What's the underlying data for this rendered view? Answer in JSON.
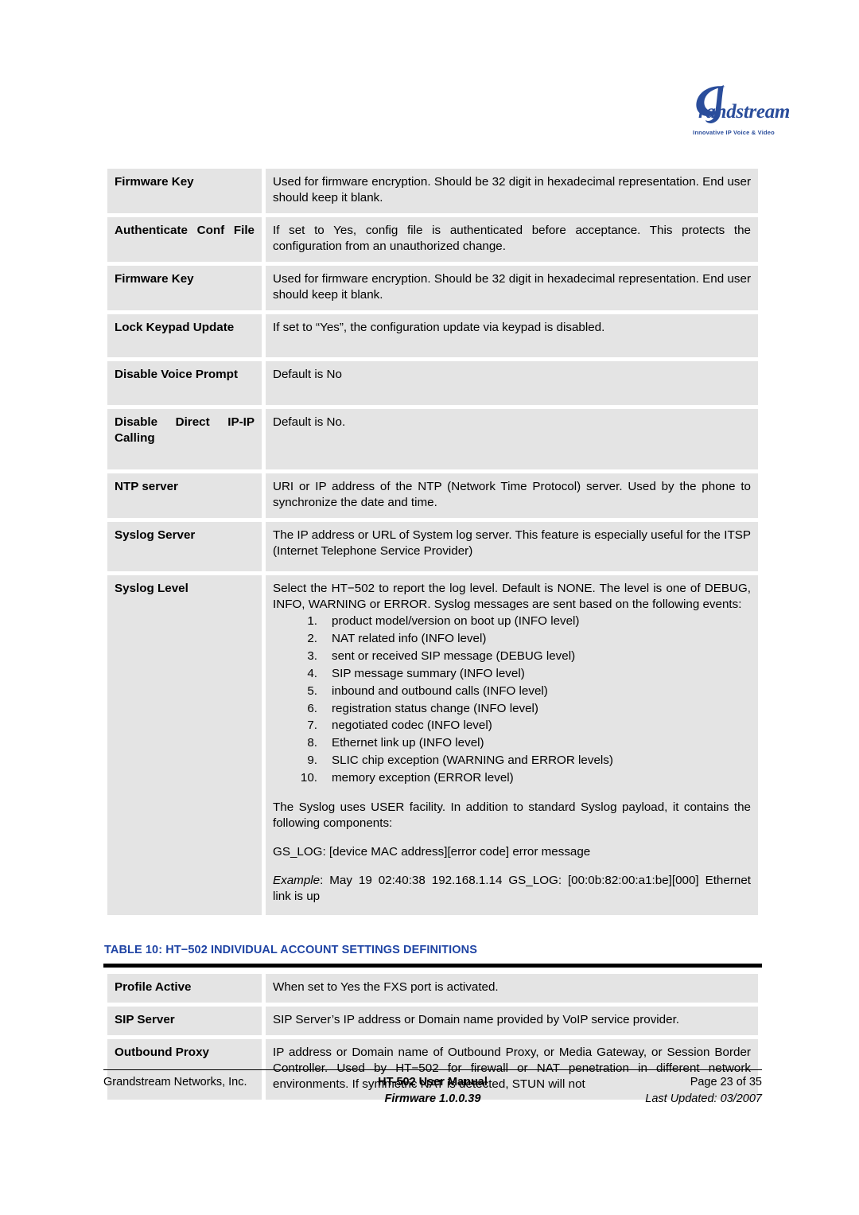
{
  "logo": {
    "wordmark": "randstream",
    "initial": "G",
    "tagline": "Innovative IP Voice & Video",
    "color": "#2a4d9b"
  },
  "advanced_table": {
    "rows": [
      {
        "key": "Firmware Key",
        "value": "Used for firmware encryption.  Should be 32 digit in hexadecimal representation. End user should keep it blank."
      },
      {
        "key": "Authenticate Conf File",
        "value": "If set to Yes, config file is authenticated before acceptance.  This protects the configuration from an unauthorized change."
      },
      {
        "key": "Firmware Key",
        "value": "Used for firmware encryption.  Should be 32 digit in hexadecimal representation. End user should keep it blank."
      },
      {
        "key": "Lock Keypad Update",
        "value": "If set to “Yes”, the configuration update via keypad is disabled."
      },
      {
        "key": "Disable Voice Prompt",
        "value": "Default is No"
      },
      {
        "key": "Disable Direct IP-IP Calling",
        "value": "Default is No."
      },
      {
        "key": "NTP server",
        "value": "URI or IP address of the NTP (Network Time Protocol) server.  Used by the phone to synchronize the date and time."
      },
      {
        "key": "Syslog Server",
        "value": "The IP address or URL of System log server.  This feature is especially useful for the ITSP (Internet Telephone Service Provider)"
      }
    ],
    "syslog_level": {
      "key": "Syslog Level",
      "intro": "Select the HT−502  to report the log level. Default is NONE. The level is one of DEBUG, INFO, WARNING or ERROR. Syslog messages are sent based on the following events:",
      "events": [
        {
          "num": "1.",
          "text": "product model/version on boot up (INFO level)"
        },
        {
          "num": "2.",
          "text": "NAT related info (INFO level)"
        },
        {
          "num": "3.",
          "text": "sent or received SIP message (DEBUG level)"
        },
        {
          "num": "4.",
          "text": "SIP message summary (INFO level)"
        },
        {
          "num": "5.",
          "text": "inbound and outbound calls (INFO level)"
        },
        {
          "num": "6.",
          "text": "registration status change (INFO level)"
        },
        {
          "num": "7.",
          "text": "negotiated codec (INFO level)"
        },
        {
          "num": "8.",
          "text": "Ethernet link up (INFO level)"
        },
        {
          "num": "9.",
          "text": "SLIC chip exception (WARNING and ERROR levels)"
        },
        {
          "num": "10.",
          "text": "memory exception (ERROR level)"
        }
      ],
      "facility_note": "The Syslog uses USER facility.  In addition to standard Syslog payload, it contains the following components:",
      "format_line": "GS_LOG: [device MAC address][error code] error message",
      "example_label": "Example",
      "example_text": ":   May 19 02:40:38 192.168.1.14 GS_LOG: [00:0b:82:00:a1:be][000] Ethernet link is up"
    }
  },
  "table_caption": {
    "full": "TABLE 10:  HT−502 INDIVIDUAL ACCOUNT SETTINGS DEFINITIONS",
    "color": "#1f44a4"
  },
  "account_table": {
    "rows": [
      {
        "key": "Profile Active",
        "value": "When set to Yes the FXS port is activated."
      },
      {
        "key": "SIP Server",
        "value": "SIP Server’s IP address or Domain name provided by VoIP service provider."
      },
      {
        "key": "Outbound Proxy",
        "value": "IP address or Domain name of Outbound Proxy, or Media Gateway, or Session Border Controller.  Used by HT−502 for firewall or NAT penetration in different network environments.  If symmetric NAT is detected, STUN will not"
      }
    ]
  },
  "footer": {
    "company": "Grandstream Networks, Inc.",
    "doc_title": "HT-502 User Manual",
    "page": "Page 23 of 35",
    "firmware": "Firmware 1.0.0.39",
    "updated": "Last Updated:  03/2007"
  }
}
